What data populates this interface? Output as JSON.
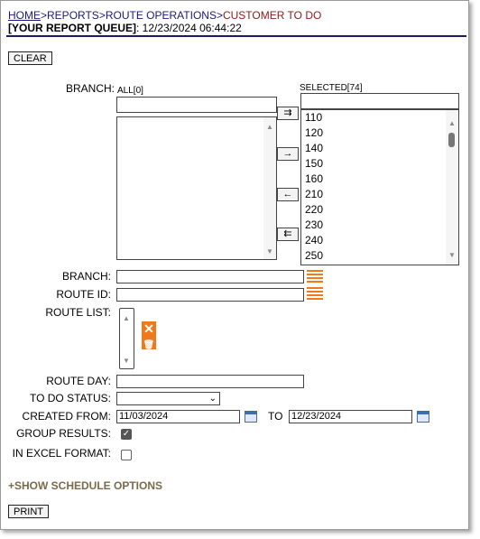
{
  "breadcrumb": {
    "home": "HOME",
    "sep1": ">",
    "reports": "REPORTS",
    "sep2": ">",
    "route_ops": "ROUTE OPERATIONS",
    "sep3": ">",
    "current": "CUSTOMER TO DO"
  },
  "queue": {
    "label": "[YOUR REPORT QUEUE]",
    "timestamp": ": 12/23/2024 06:44:22"
  },
  "buttons": {
    "clear": "CLEAR",
    "print": "PRINT"
  },
  "branch_picker": {
    "label": "BRANCH:",
    "all_label": "ALL[0]",
    "selected_label": "SELECTED[74]",
    "all_items": [],
    "selected_items": [
      "110",
      "120",
      "140",
      "150",
      "160",
      "210",
      "220",
      "230",
      "240",
      "250"
    ],
    "move_buttons": [
      "⇉",
      "→",
      "←",
      "⇇"
    ]
  },
  "fields": {
    "branch": {
      "label": "BRANCH:",
      "value": ""
    },
    "route_id": {
      "label": "ROUTE ID:",
      "value": ""
    },
    "route_list": {
      "label": "ROUTE LIST:"
    },
    "route_day": {
      "label": "ROUTE DAY:",
      "value": ""
    },
    "todo_status": {
      "label": "TO DO STATUS:",
      "value": ""
    },
    "created_from": {
      "label": "CREATED FROM:",
      "value": "11/03/2024"
    },
    "to": {
      "label": "TO",
      "value": "12/23/2024"
    },
    "group_results": {
      "label": "GROUP RESULTS:",
      "checked": true
    },
    "excel": {
      "label": "IN EXCEL FORMAT:",
      "checked": false
    }
  },
  "schedule": {
    "toggle": "+SHOW SCHEDULE OPTIONS"
  },
  "icons": {
    "list": "list-icon",
    "calendar": "calendar-icon",
    "delete": "delete-icon",
    "accent": "#f07a1a"
  }
}
